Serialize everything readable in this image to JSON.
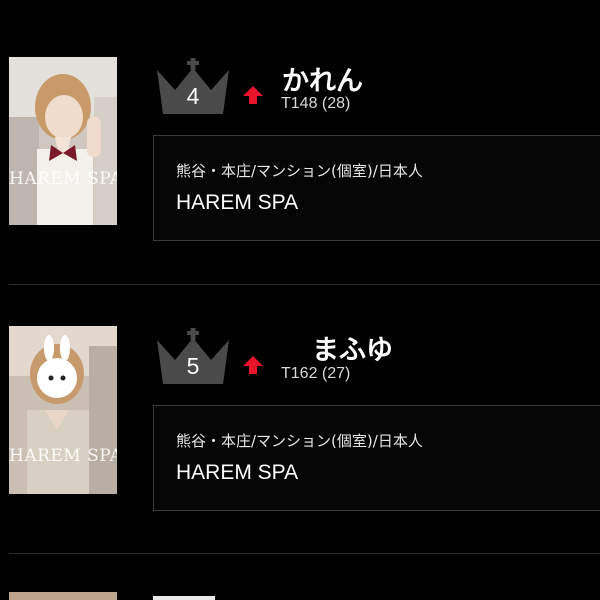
{
  "ranking": [
    {
      "rank": "4",
      "name": "かれん",
      "stats": "T148 (28)",
      "area": "熊谷・本庄/マンション(個室)/日本人",
      "shop": "HAREM SPA",
      "photo_watermark": "HAREM SPA",
      "trend": "up-arrow-icon"
    },
    {
      "rank": "5",
      "name": "まふゆ",
      "stats": "T162 (27)",
      "area": "熊谷・本庄/マンション(個室)/日本人",
      "shop": "HAREM SPA",
      "photo_watermark": "HAREM SPA",
      "trend": "up-arrow-icon"
    }
  ],
  "colors": {
    "background": "#000000",
    "crown": "#4a4a4a",
    "arrow": "#e8152a",
    "border": "#3a3a3a"
  }
}
